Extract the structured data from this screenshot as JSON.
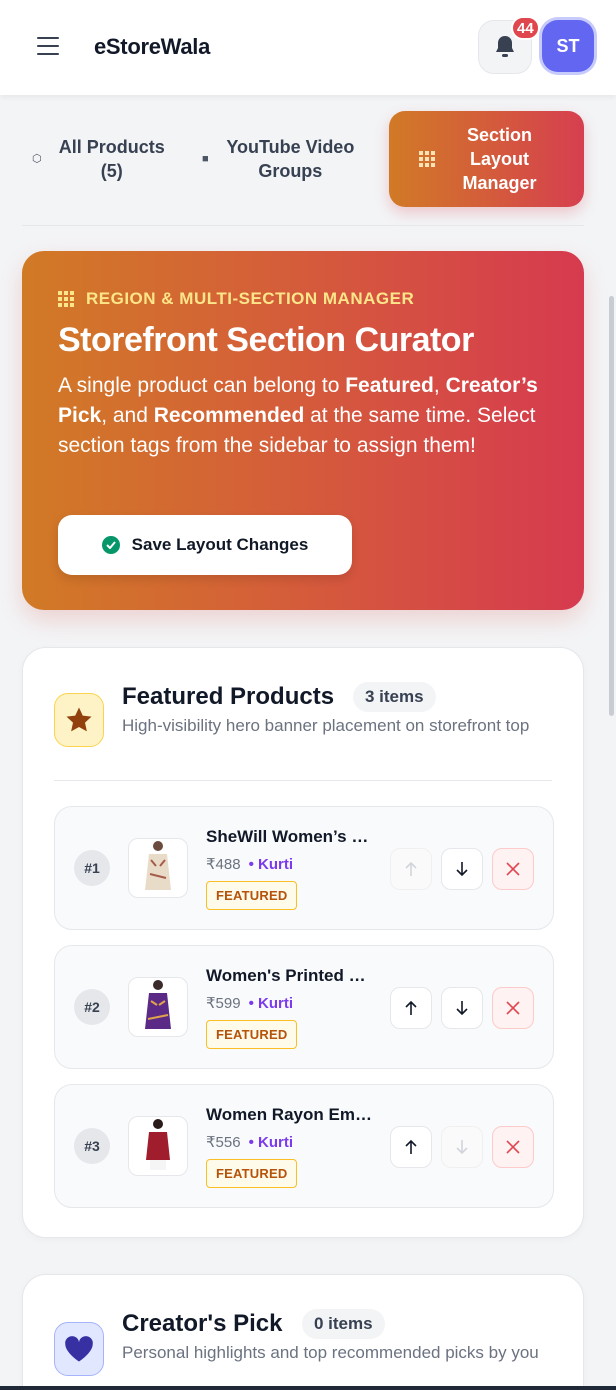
{
  "header": {
    "brand": "eStoreWala",
    "notification_count": "44",
    "avatar_initials": "ST"
  },
  "tabs": [
    {
      "label": "All Products (5)",
      "icon": "box-icon",
      "active": false
    },
    {
      "label": "YouTube Video Groups",
      "icon": "video-icon",
      "active": false
    },
    {
      "label": "Section Layout Manager",
      "icon": "grid-icon",
      "active": true
    }
  ],
  "hero": {
    "eyebrow": "REGION & MULTI-SECTION MANAGER",
    "title": "Storefront Section Curator",
    "desc_1": "A single product can belong to ",
    "desc_featured": "Featured",
    "desc_2": ", ",
    "desc_creator": "Creator’s Pick",
    "desc_3": ", and ",
    "desc_recommended": "Recommended",
    "desc_4": " at the same time. Select section tags from the sidebar to assign them!",
    "save_label": "Save Layout Changes"
  },
  "sections": [
    {
      "title": "Featured Products",
      "count": "3 items",
      "desc": "High-visibility hero banner placement on storefront top",
      "icon": "star-icon",
      "products": [
        {
          "rank": "#1",
          "name": "SheWill Women’s Printed...",
          "price": "₹488",
          "category": "• Kurti",
          "tag": "FEATURED",
          "up_disabled": true,
          "down_disabled": false
        },
        {
          "rank": "#2",
          "name": "Women's Printed Rayon...",
          "price": "₹599",
          "category": "• Kurti",
          "tag": "FEATURED",
          "up_disabled": false,
          "down_disabled": false
        },
        {
          "rank": "#3",
          "name": "Women Rayon Embroidered...",
          "price": "₹556",
          "category": "• Kurti",
          "tag": "FEATURED",
          "up_disabled": false,
          "down_disabled": true
        }
      ]
    },
    {
      "title": "Creator's Pick",
      "count": "0 items",
      "desc": "Personal highlights and top recommended picks by you",
      "icon": "heart-icon",
      "products": []
    }
  ],
  "colors": {
    "accent_start": "#d17a26",
    "accent_end": "#d63f4f",
    "badge_red": "#e0464e",
    "avatar": "#6366f1",
    "category_purple": "#7c3aed"
  }
}
